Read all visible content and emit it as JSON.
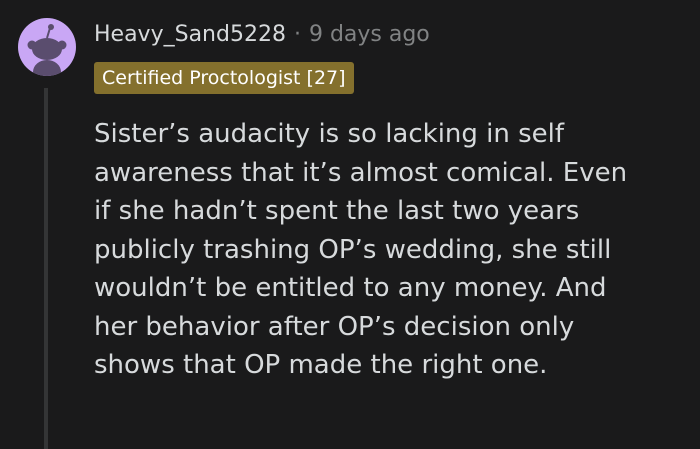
{
  "comment": {
    "username": "Heavy_Sand5228",
    "separator": "·",
    "timestamp": "9 days ago",
    "flair": "Certified Proctologist [27]",
    "body_lines": [
      "Sister’s audacity is so lacking in self",
      "awareness that it’s almost comical. Even",
      "if she hadn’t spent the last two years",
      "publicly trashing OP’s wedding, she still",
      "wouldn’t be entitled to any money. And",
      "her behavior after OP’s decision only",
      "shows that OP made the right one."
    ]
  },
  "colors": {
    "background": "#1a1a1b",
    "avatar_bg": "#c9a7f5",
    "flair_bg": "#84702d",
    "text": "#d7dadc",
    "muted": "#818384",
    "thread_line": "#343536"
  },
  "icons": {
    "avatar": "snoo-avatar-icon"
  }
}
